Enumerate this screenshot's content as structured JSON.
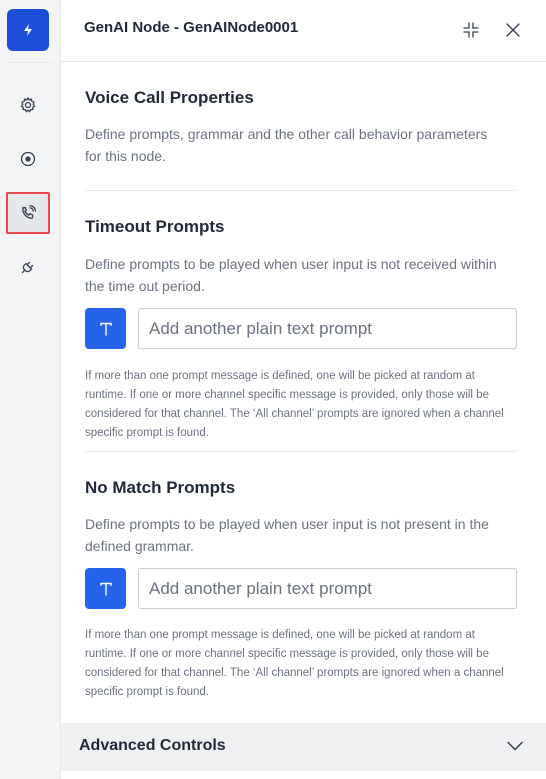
{
  "header": {
    "title": "GenAI Node - GenAINode0001"
  },
  "rail": {
    "items": [
      {
        "icon": "lightning-icon"
      },
      {
        "icon": "gear-icon"
      },
      {
        "icon": "target-icon"
      },
      {
        "icon": "phone-call-icon",
        "active": true
      },
      {
        "icon": "plug-icon"
      }
    ]
  },
  "voice_call": {
    "title": "Voice Call Properties",
    "description": "Define prompts, grammar and the other call behavior parameters for this node."
  },
  "timeout": {
    "title": "Timeout Prompts",
    "description": "Define prompts to be played when user input is not received within the time out period.",
    "input_placeholder": "Add another plain text prompt",
    "help": "If more than one prompt message is defined, one will be picked at random at runtime. If one or more channel specific message is provided, only those will be considered for that channel. The ‘All channel’ prompts are ignored when a channel specific prompt is found."
  },
  "no_match": {
    "title": "No Match Prompts",
    "description": "Define prompts to be played when user input is not present in the defined grammar.",
    "input_placeholder": "Add another plain text prompt",
    "help": "If more than one prompt message is defined, one will be picked at random at runtime. If one or more channel specific message is provided, only those will be considered for that channel. The ‘All channel’ prompts are ignored when a channel specific prompt is found."
  },
  "advanced": {
    "title": "Advanced Controls"
  },
  "colors": {
    "accent": "#2563eb",
    "logo_bg": "#1d4ed8",
    "active_outline": "#e5484d"
  }
}
